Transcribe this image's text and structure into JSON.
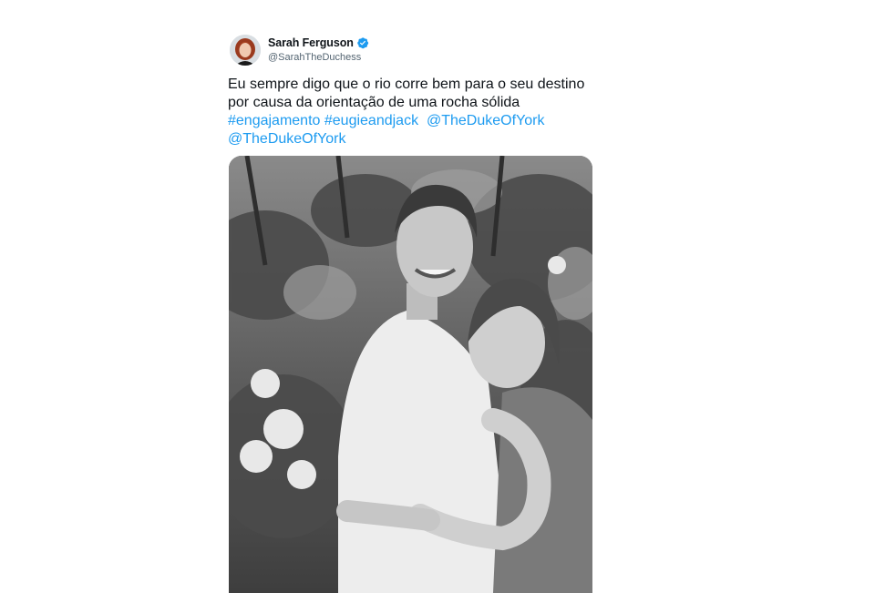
{
  "author": {
    "display_name": "Sarah Ferguson",
    "handle": "@SarahTheDuchess",
    "verified_icon": "verified-badge-icon",
    "badge_color": "#1d9bf0"
  },
  "tweet": {
    "line1": "Eu sempre digo que o rio corre bem para o seu destino",
    "line2": "por causa da orientação de uma rocha sólida",
    "hashtag1": "#engajamento",
    "hashtag2": "#eugieandjack",
    "mention1": "@TheDukeOfYork",
    "mention2": "@TheDukeOfYork"
  },
  "colors": {
    "link": "#1d9bf0",
    "text": "#0f1419",
    "secondary": "#536471"
  }
}
